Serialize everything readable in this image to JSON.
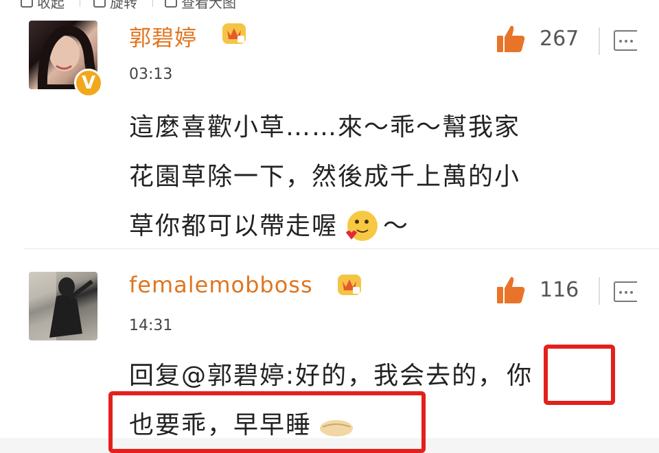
{
  "toolbar": {
    "collapse_label": "收起",
    "rotate_label": "旋转",
    "view_large_label": "查看大图"
  },
  "comments": [
    {
      "user": "郭碧婷",
      "verified_badge": "V",
      "time": "03:13",
      "likes": "267",
      "lines": [
        "這麼喜歡小草……來～乖～幫我家",
        "花園草除一下，然後成千上萬的小",
        "草你都可以帶走喔",
        "～"
      ]
    },
    {
      "user": "femalemobboss",
      "time": "14:31",
      "likes": "116",
      "reply_line1": "回复@郭碧婷:好的，我会去的，",
      "reply_highlight": "你",
      "reply_line2": "也要乖，早早睡"
    }
  ],
  "colors": {
    "username": "#e0751f",
    "like_icon": "#e8742a",
    "highlight_box": "#e3201b",
    "badge": "#f2a81d"
  },
  "icons": [
    "collapse-icon",
    "rotate-icon",
    "view-large-icon",
    "crown-level-icon",
    "thumbs-up-icon",
    "more-icon",
    "tongue-emoji-icon",
    "sleep-emoji-icon"
  ]
}
